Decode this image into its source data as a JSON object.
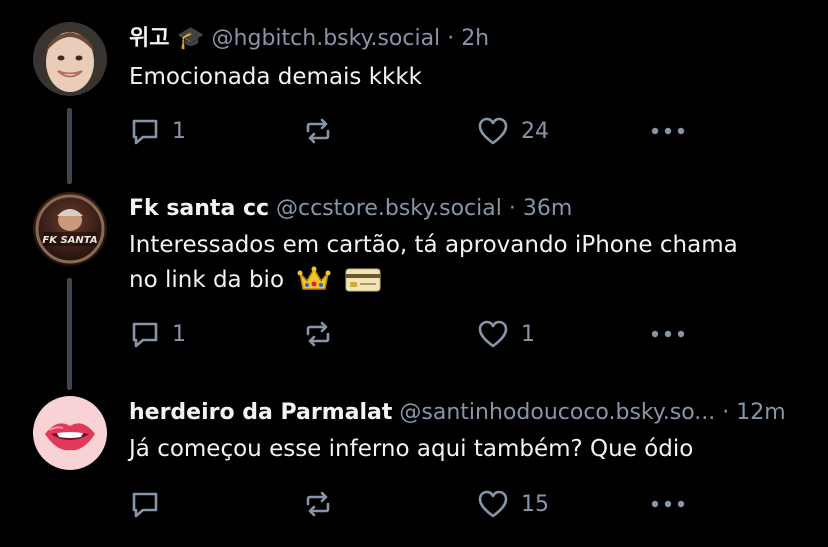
{
  "posts": [
    {
      "name": "위고 🎓",
      "handle": "@hgbitch.bsky.social",
      "separator": "·",
      "time": "2h",
      "text": "Emocionada demais kkkk",
      "reply_count": "1",
      "like_count": "24",
      "avatar_icon": "woman-smiling-photo-avatar"
    },
    {
      "name": "Fk santa cc",
      "handle": "@ccstore.bsky.social",
      "separator": "·",
      "time": "36m",
      "text_line1": "Interessados em cartão, tá aprovando iPhone chama",
      "text_line2": "no link da bio",
      "emojis": [
        "crown-emoji",
        "credit-card-emoji"
      ],
      "reply_count": "1",
      "like_count": "1",
      "avatar_icon": "fk-santa-logo-avatar",
      "avatar_logo_text": "FK SANTA"
    },
    {
      "name": "herdeiro da Parmalat",
      "handle": "@santinhodoucoco.bsky.so...",
      "separator": "·",
      "time": "12m",
      "text": "Já começou esse inferno aqui também? Que ódio",
      "reply_count": "",
      "like_count": "15",
      "avatar_icon": "biting-lips-avatar"
    }
  ],
  "colors": {
    "background": "#000000",
    "text": "#f1f3f5",
    "muted": "#8795a8",
    "thread_line": "#3b4650"
  }
}
